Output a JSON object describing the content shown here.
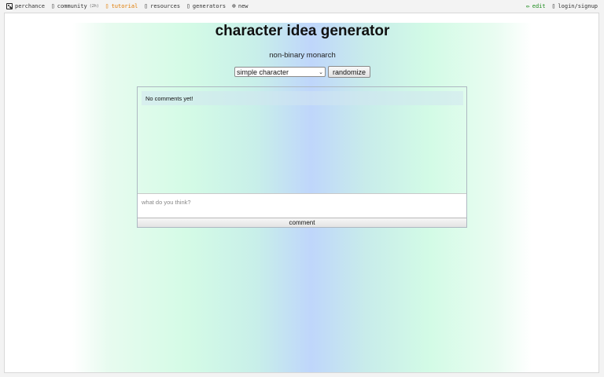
{
  "topnav": {
    "left": [
      {
        "label": "perchance"
      },
      {
        "label": "community",
        "badge": "(2h)"
      },
      {
        "label": "tutorial"
      },
      {
        "label": "resources"
      },
      {
        "label": "generators"
      },
      {
        "label": "new"
      }
    ],
    "right": [
      {
        "label": "edit"
      },
      {
        "label": "login/signup"
      }
    ]
  },
  "page": {
    "title": "character idea generator",
    "result": "non-binary monarch",
    "select_value": "simple character",
    "randomize_label": "randomize"
  },
  "comments": {
    "empty_text": "No comments yet!",
    "input_placeholder": "what do you think?",
    "submit_label": "comment"
  },
  "colors": {
    "tutorial_link": "#e07b00",
    "edit_link": "#1a8a1a",
    "gradient_center": "#bfd6fb",
    "gradient_side": "#d4fbe6"
  }
}
